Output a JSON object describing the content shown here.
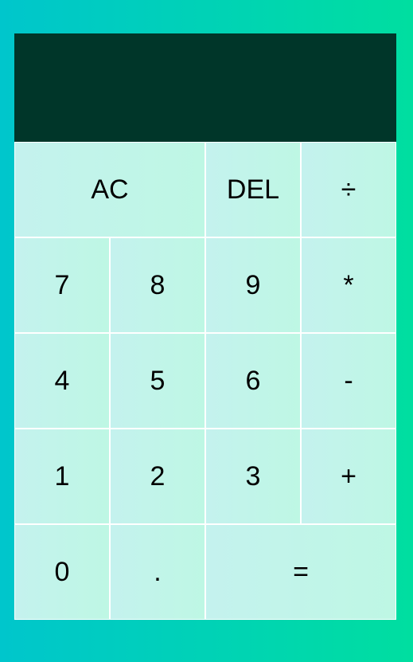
{
  "display": {
    "previous_operand": "",
    "current_operand": ""
  },
  "keys": {
    "ac": "AC",
    "del": "DEL",
    "divide": "÷",
    "seven": "7",
    "eight": "8",
    "nine": "9",
    "multiply": "*",
    "four": "4",
    "five": "5",
    "six": "6",
    "subtract": "-",
    "one": "1",
    "two": "2",
    "three": "3",
    "add": "+",
    "zero": "0",
    "decimal": ".",
    "equals": "="
  },
  "colors": {
    "display_background": "#003629",
    "key_background": "#c4f2ee",
    "page_gradient_start": "#00c6cc",
    "page_gradient_end": "#00dea0"
  }
}
